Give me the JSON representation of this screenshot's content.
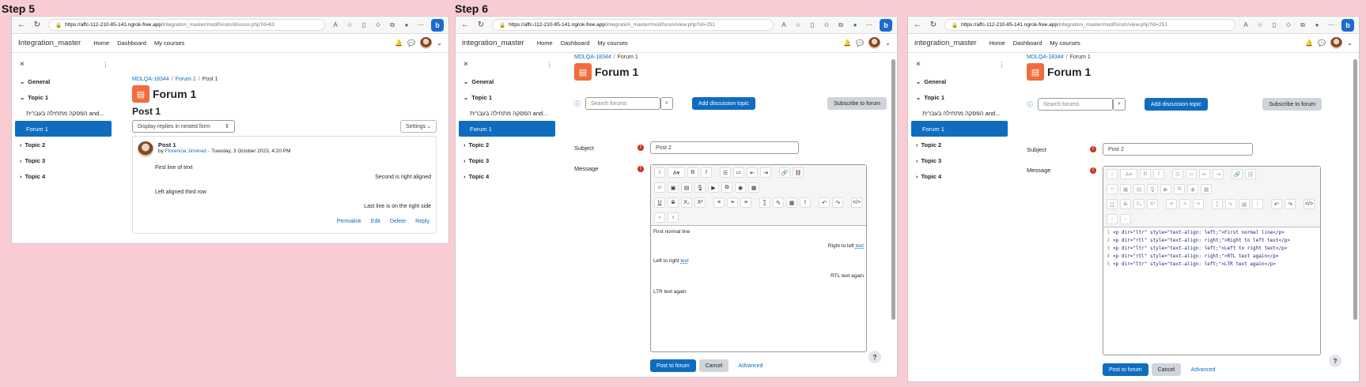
{
  "steps": {
    "step5": "Step 5",
    "step6": "Step 6"
  },
  "browser": {
    "url1_host": "https://affc-112-210-85-141.ngrok-free.app",
    "url1_path": "/integration_master/mod/forum/discuss.php?d=63",
    "url2_host": "https://affc-112-210-85-141.ngrok-free.app",
    "url2_path": "/integration_master/mod/forum/view.php?id=251",
    "url3_host": "https://affc-112-210-85-141.ngrok-free.app",
    "url3_path": "/integration_master/mod/forum/view.php?id=251"
  },
  "header": {
    "site1": "Integration_master",
    "site2": "integration_master",
    "site3": "integration_master",
    "home": "Home",
    "dashboard": "Dashboard",
    "courses": "My courses"
  },
  "drawer": {
    "general": "General",
    "topic1": "Topic 1",
    "hebrew": "הפסקה מתחילה בעברית and...",
    "forum1": "Forum 1",
    "topic2": "Topic 2",
    "topic3": "Topic 3",
    "topic4": "Topic 4"
  },
  "panel1": {
    "crumb1": "MDLQA-18344",
    "crumb2": "Forum 1",
    "crumb3": "Post 1",
    "title": "Forum 1",
    "post_heading": "Post 1",
    "display_mode": "Display replies in nested form",
    "settings": "Settings",
    "post_title": "Post 1",
    "by": "by",
    "author": "Florencia Jiménez",
    "date": "- Tuesday, 3 October 2023, 4:20 PM",
    "line1": "First line of text",
    "line2": "Second is right aligned",
    "line3": "Left aligned third row",
    "line4": "Last line is on the right side",
    "permalink": "Permalink",
    "edit": "Edit",
    "delete": "Delete",
    "reply": "Reply"
  },
  "form": {
    "crumb1": "MDLQA-18344",
    "crumb2": "Forum 1",
    "title": "Forum 1",
    "search_placeholder": "Search forums",
    "add_topic": "Add discussion topic",
    "subscribe": "Subscribe to forum",
    "subject_label": "Subject",
    "subject_value": "Post 2",
    "message_label": "Message",
    "post_button": "Post to forum",
    "cancel": "Cancel",
    "advanced": "Advanced"
  },
  "editor_text": {
    "l1": "First normal line",
    "l2a": "Right to left ",
    "l2b": "text",
    "l3a": "Left to right ",
    "l3b": "text",
    "l4": "RTL text again",
    "l5": "LTR text again"
  },
  "code": [
    {
      "n": "1",
      "t": "<p dir=\"ltr\" style=\"text-align: left;\">First normal line</p>"
    },
    {
      "n": "2",
      "t": "<p dir=\"rtl\" style=\"text-align: right;\">Right to left text</p>"
    },
    {
      "n": "3",
      "t": "<p dir=\"ltr\" style=\"text-align: left;\">Left to right text</p>"
    },
    {
      "n": "4",
      "t": "<p dir=\"rtl\" style=\"text-align: right;\">RTL text again</p>"
    },
    {
      "n": "5",
      "t": "<p dir=\"ltr\" style=\"text-align: left;\">LTR text again</p>"
    }
  ]
}
